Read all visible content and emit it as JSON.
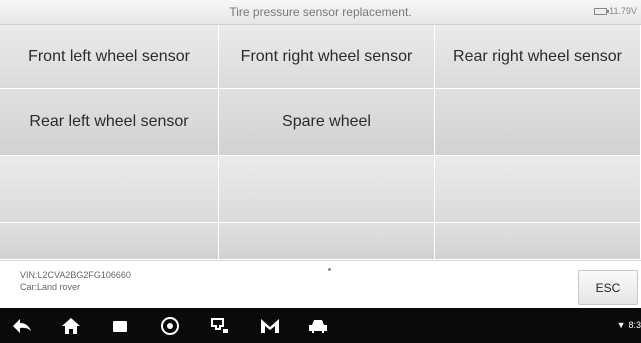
{
  "header": {
    "title": "Tire pressure sensor replacement.",
    "battery_text": "11.79V"
  },
  "grid": {
    "row1": [
      "Front left wheel sensor",
      "Front right wheel sensor",
      "Rear right wheel sensor"
    ],
    "row2": [
      "Rear left wheel sensor",
      "Spare wheel",
      ""
    ]
  },
  "footer": {
    "vin": "VIN:L2CVA2BG2FG106660",
    "car": "Car:Land rover",
    "esc_label": "ESC"
  },
  "navbar": {
    "icons": [
      "back-icon",
      "home-icon",
      "recent-apps-icon",
      "chrome-icon",
      "vci-connect-icon",
      "m-logo-icon",
      "car-icon"
    ],
    "status_time": "8:3"
  },
  "colors": {
    "cell_bg": "#e3e3e3",
    "navbar_bg": "#0a0a0a",
    "text": "#2b2b2b"
  }
}
